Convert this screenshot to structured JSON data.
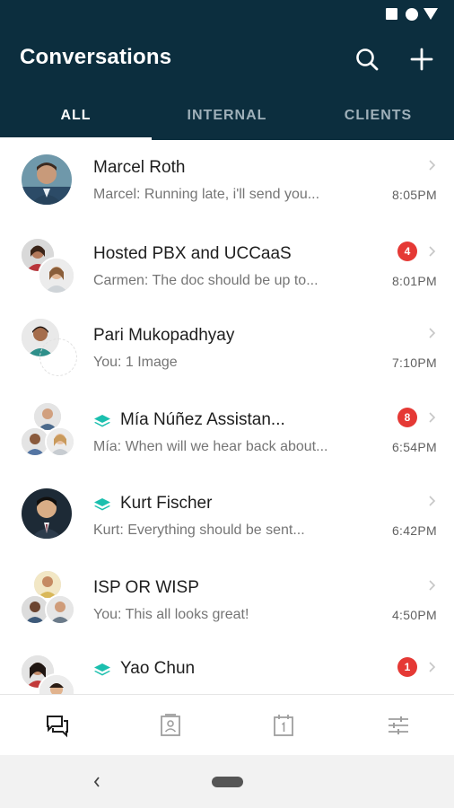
{
  "app": {
    "title": "Conversations"
  },
  "tabs": [
    {
      "label": "ALL",
      "active": true
    },
    {
      "label": "INTERNAL",
      "active": false
    },
    {
      "label": "CLIENTS",
      "active": false
    }
  ],
  "colors": {
    "header": "#0c2e3e",
    "badge": "#e53935",
    "tag": "#1bbfae"
  },
  "conversations": [
    {
      "name": "Marcel Roth",
      "preview": "Marcel: Running late, i'll send you...",
      "time": "8:05PM",
      "badge": null,
      "tagged": false,
      "avatar_type": "single"
    },
    {
      "name": "Hosted PBX and UCCaaS",
      "preview": "Carmen: The doc should be up to...",
      "time": "8:01PM",
      "badge": "4",
      "tagged": false,
      "avatar_type": "pair"
    },
    {
      "name": "Pari Mukopadhyay",
      "preview": "You: 1 Image",
      "time": "7:10PM",
      "badge": null,
      "tagged": false,
      "avatar_type": "single-ring"
    },
    {
      "name": "Mía Núñez Assistan...",
      "preview": "Mía: When will we hear back about...",
      "time": "6:54PM",
      "badge": "8",
      "tagged": true,
      "avatar_type": "triple"
    },
    {
      "name": "Kurt Fischer",
      "preview": "Kurt: Everything should be sent...",
      "time": "6:42PM",
      "badge": null,
      "tagged": true,
      "avatar_type": "single"
    },
    {
      "name": "ISP OR WISP",
      "preview": "You: This all looks great!",
      "time": "4:50PM",
      "badge": null,
      "tagged": false,
      "avatar_type": "triple"
    },
    {
      "name": "Yao Chun",
      "preview": "",
      "time": "",
      "badge": "1",
      "tagged": true,
      "avatar_type": "pair"
    }
  ],
  "bottom_nav": [
    {
      "icon": "chat-bubbles-icon",
      "active": true
    },
    {
      "icon": "contacts-icon",
      "active": false
    },
    {
      "icon": "calendar-icon",
      "active": false
    },
    {
      "icon": "settings-sliders-icon",
      "active": false
    }
  ],
  "system_nav": {
    "back_glyph": "‹"
  }
}
